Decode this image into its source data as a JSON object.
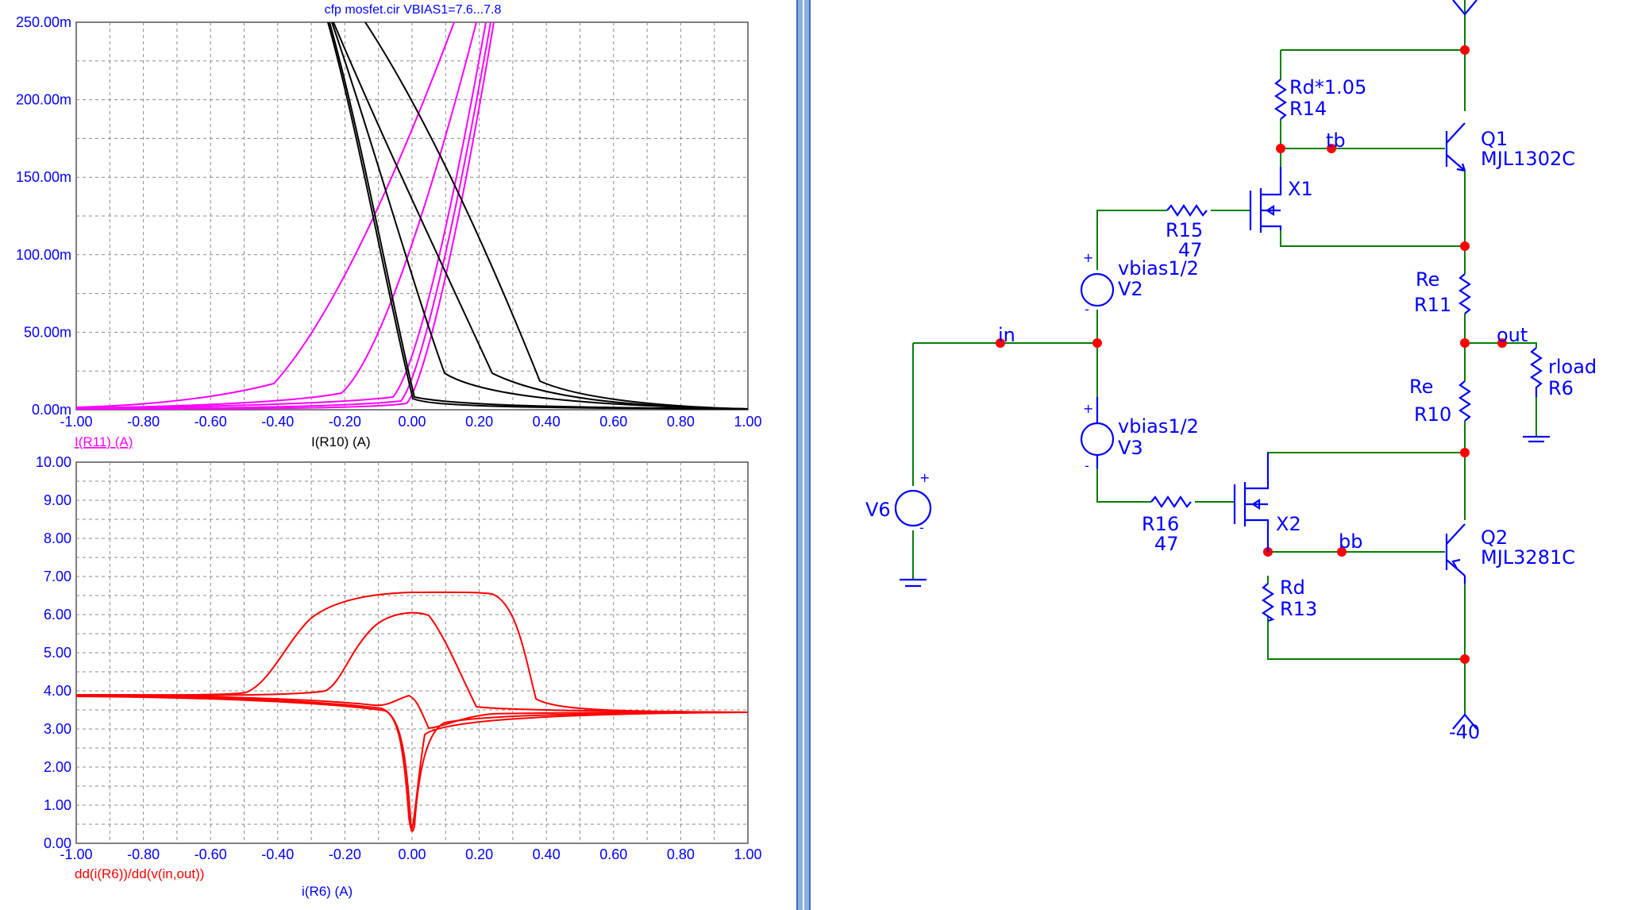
{
  "plot": {
    "title": "cfp mosfet.cir VBIAS1=7.6...7.8",
    "top": {
      "y_ticks": [
        "250.00m",
        "200.00m",
        "150.00m",
        "100.00m",
        "50.00m",
        "0.00m"
      ],
      "x_ticks": [
        "-1.00",
        "-0.80",
        "-0.60",
        "-0.40",
        "-0.20",
        "0.00",
        "0.20",
        "0.40",
        "0.60",
        "0.80",
        "1.00"
      ],
      "trace_label_left": "I(R11) (A)",
      "trace_label_center": "I(R10) (A)",
      "colors": {
        "left": "#ff00ff",
        "center": "#000000"
      }
    },
    "bottom": {
      "y_ticks": [
        "10.00",
        "9.00",
        "8.00",
        "7.00",
        "6.00",
        "5.00",
        "4.00",
        "3.00",
        "2.00",
        "1.00",
        "0.00"
      ],
      "x_ticks": [
        "-1.00",
        "-0.80",
        "-0.60",
        "-0.40",
        "-0.20",
        "0.00",
        "0.20",
        "0.40",
        "0.60",
        "0.80",
        "1.00"
      ],
      "trace_label": "dd(i(R6))/dd(v(in,out))",
      "x_label": "i(R6) (A)",
      "color": "#ff0000"
    }
  },
  "schematic": {
    "labels": {
      "rd105": "Rd*1.05",
      "r14": "R14",
      "tb": "tb",
      "q1": "Q1",
      "q1_part": "MJL1302C",
      "x1": "X1",
      "r15": "R15",
      "r15_val": "47",
      "v2_val": "vbias1/2",
      "v2": "V2",
      "re_top": "Re",
      "r11": "R11",
      "in": "in",
      "out": "out",
      "rload": "rload",
      "r6": "R6",
      "re_bot": "Re",
      "r10": "R10",
      "v3_val": "vbias1/2",
      "v3": "V3",
      "v6": "V6",
      "r16": "R16",
      "r16_val": "47",
      "x2": "X2",
      "bb": "bb",
      "q2": "Q2",
      "q2_part": "MJL3281C",
      "rd": "Rd",
      "r13": "R13",
      "neg_supply": "-40",
      "plus": "+",
      "minus": "-"
    },
    "colors": {
      "wire": "#008000",
      "component": "#0000ff",
      "node": "#ff0000",
      "text": "#0000ff"
    }
  }
}
